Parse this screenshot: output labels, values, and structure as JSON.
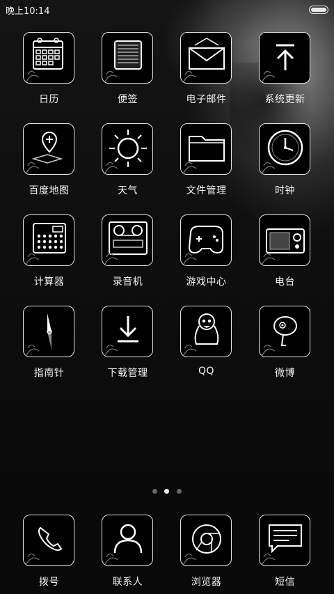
{
  "status_bar": {
    "time": "晚上10:14"
  },
  "apps": [
    {
      "label": "日历",
      "icon": "calendar-icon"
    },
    {
      "label": "便签",
      "icon": "notes-icon"
    },
    {
      "label": "电子邮件",
      "icon": "email-icon"
    },
    {
      "label": "系统更新",
      "icon": "update-arrow-icon"
    },
    {
      "label": "百度地图",
      "icon": "map-pin-icon"
    },
    {
      "label": "天气",
      "icon": "sun-icon"
    },
    {
      "label": "文件管理",
      "icon": "folder-icon"
    },
    {
      "label": "时钟",
      "icon": "clock-icon"
    },
    {
      "label": "计算器",
      "icon": "calculator-icon"
    },
    {
      "label": "录音机",
      "icon": "tape-recorder-icon"
    },
    {
      "label": "游戏中心",
      "icon": "gamepad-icon"
    },
    {
      "label": "电台",
      "icon": "radio-icon"
    },
    {
      "label": "指南针",
      "icon": "compass-icon"
    },
    {
      "label": "下载管理",
      "icon": "download-icon"
    },
    {
      "label": "QQ",
      "icon": "penguin-icon"
    },
    {
      "label": "微博",
      "icon": "weibo-icon"
    }
  ],
  "page_indicator": {
    "count": 3,
    "active_index": 1
  },
  "dock": [
    {
      "label": "拨号",
      "icon": "phone-icon"
    },
    {
      "label": "联系人",
      "icon": "contact-icon"
    },
    {
      "label": "浏览器",
      "icon": "browser-icon"
    },
    {
      "label": "短信",
      "icon": "message-icon"
    }
  ]
}
